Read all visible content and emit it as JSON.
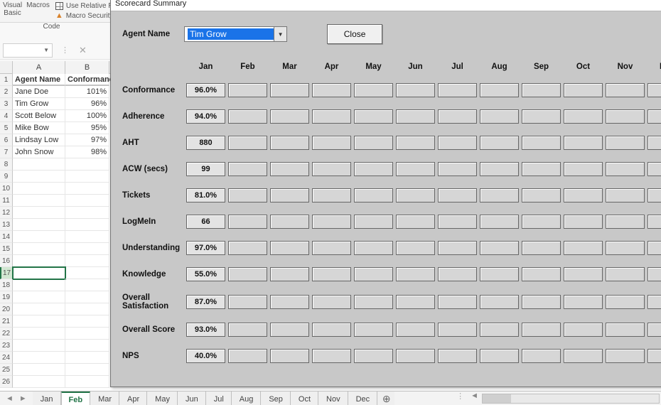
{
  "ribbon": {
    "visual": "Visual",
    "basic": "Basic",
    "macros": "Macros",
    "relative": "Use Relative Re",
    "macroSecurity": "Macro Security",
    "codeGroup": "Code"
  },
  "sheet": {
    "colA": "A",
    "colB": "B",
    "headers": {
      "agentName": "Agent Name",
      "conformance": "Conformance"
    },
    "rows": [
      {
        "name": "Jane Doe",
        "conf": "101%"
      },
      {
        "name": "Tim Grow",
        "conf": "96%"
      },
      {
        "name": "Scott Below",
        "conf": "100%"
      },
      {
        "name": "Mike Bow",
        "conf": "95%"
      },
      {
        "name": "Lindsay Low",
        "conf": "97%"
      },
      {
        "name": "John Snow",
        "conf": "98%"
      }
    ],
    "selectedRow": 17
  },
  "form": {
    "title": "Scorecard Summary",
    "agentNameLabel": "Agent Name",
    "selectedAgent": "Tim Grow",
    "closeLabel": "Close",
    "months": [
      "Jan",
      "Feb",
      "Mar",
      "Apr",
      "May",
      "Jun",
      "Jul",
      "Aug",
      "Sep",
      "Oct",
      "Nov",
      "Dec"
    ],
    "metrics": [
      {
        "label": "Conformance",
        "values": [
          "96.0%",
          "",
          "",
          "",
          "",
          "",
          "",
          "",
          "",
          "",
          "",
          ""
        ]
      },
      {
        "label": "Adherence",
        "values": [
          "94.0%",
          "",
          "",
          "",
          "",
          "",
          "",
          "",
          "",
          "",
          "",
          ""
        ]
      },
      {
        "label": "AHT",
        "values": [
          "880",
          "",
          "",
          "",
          "",
          "",
          "",
          "",
          "",
          "",
          "",
          ""
        ]
      },
      {
        "label": "ACW (secs)",
        "values": [
          "99",
          "",
          "",
          "",
          "",
          "",
          "",
          "",
          "",
          "",
          "",
          ""
        ]
      },
      {
        "label": "Tickets",
        "values": [
          "81.0%",
          "",
          "",
          "",
          "",
          "",
          "",
          "",
          "",
          "",
          "",
          ""
        ]
      },
      {
        "label": "LogMeIn",
        "values": [
          "66",
          "",
          "",
          "",
          "",
          "",
          "",
          "",
          "",
          "",
          "",
          ""
        ]
      },
      {
        "label": "Understanding",
        "values": [
          "97.0%",
          "",
          "",
          "",
          "",
          "",
          "",
          "",
          "",
          "",
          "",
          ""
        ]
      },
      {
        "label": "Knowledge",
        "values": [
          "55.0%",
          "",
          "",
          "",
          "",
          "",
          "",
          "",
          "",
          "",
          "",
          ""
        ]
      },
      {
        "label": "Overall\nSatisfaction",
        "values": [
          "87.0%",
          "",
          "",
          "",
          "",
          "",
          "",
          "",
          "",
          "",
          "",
          ""
        ]
      },
      {
        "label": "Overall Score",
        "values": [
          "93.0%",
          "",
          "",
          "",
          "",
          "",
          "",
          "",
          "",
          "",
          "",
          ""
        ]
      },
      {
        "label": "NPS",
        "values": [
          "40.0%",
          "",
          "",
          "",
          "",
          "",
          "",
          "",
          "",
          "",
          "",
          ""
        ]
      }
    ]
  },
  "tabs": {
    "list": [
      "Jan",
      "Feb",
      "Mar",
      "Apr",
      "May",
      "Jun",
      "Jul",
      "Aug",
      "Sep",
      "Oct",
      "Nov",
      "Dec"
    ],
    "active": "Feb"
  }
}
